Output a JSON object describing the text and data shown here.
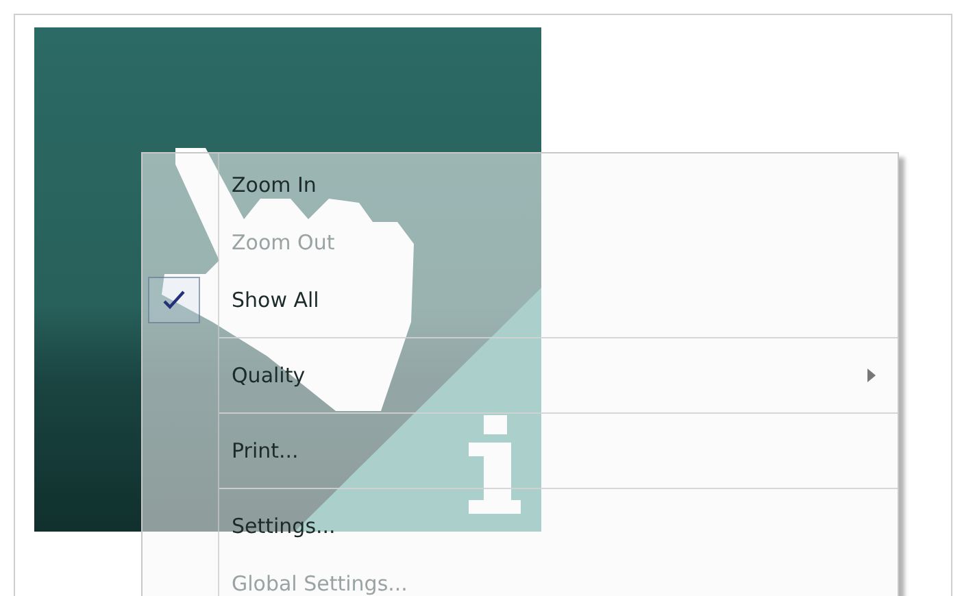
{
  "context_menu": {
    "items": [
      {
        "kind": "item",
        "label": "Zoom In",
        "disabled": false,
        "checked": false,
        "submenu": false
      },
      {
        "kind": "item",
        "label": "Zoom Out",
        "disabled": true,
        "checked": false,
        "submenu": false
      },
      {
        "kind": "item",
        "label": "Show All",
        "disabled": false,
        "checked": true,
        "submenu": false
      },
      {
        "kind": "separator"
      },
      {
        "kind": "item",
        "label": "Quality",
        "disabled": false,
        "checked": false,
        "submenu": true
      },
      {
        "kind": "separator"
      },
      {
        "kind": "item",
        "label": "Print...",
        "disabled": false,
        "checked": false,
        "submenu": false
      },
      {
        "kind": "separator"
      },
      {
        "kind": "item",
        "label": "Settings...",
        "disabled": false,
        "checked": false,
        "submenu": false
      },
      {
        "kind": "item",
        "label": "Global Settings...",
        "disabled": true,
        "checked": false,
        "submenu": false
      }
    ]
  }
}
